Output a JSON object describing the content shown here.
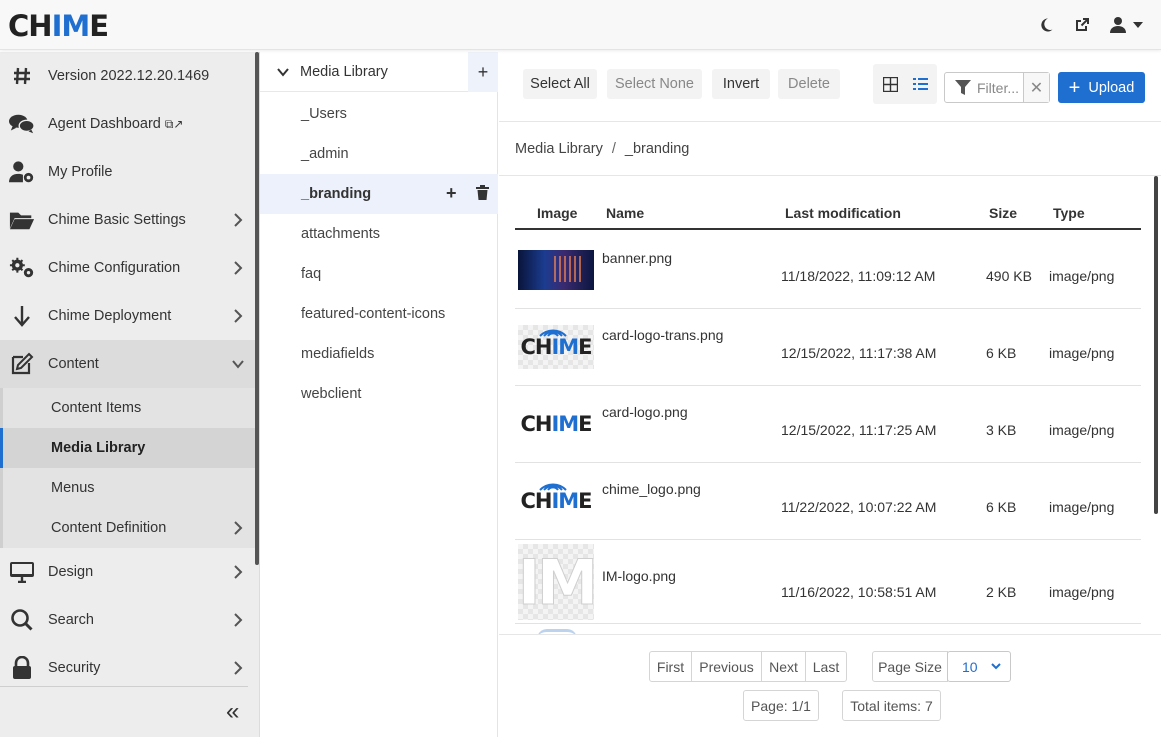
{
  "app": {
    "logo_pre": "CH",
    "logo_mid": "IM",
    "logo_post": "E",
    "accent": "#1f6fd1"
  },
  "header": {
    "icons": [
      "moon-icon",
      "external-link-icon",
      "user-icon",
      "caret-down-icon"
    ]
  },
  "sidebar": {
    "items": [
      {
        "label": "Version 2022.12.20.1469",
        "icon": "hash-icon"
      },
      {
        "label": "Agent Dashboard",
        "suffix": "⧉↗",
        "icon": "chat-icon"
      },
      {
        "label": "My Profile",
        "icon": "user-cog-icon"
      },
      {
        "label": "Chime Basic Settings",
        "icon": "folder-open-icon"
      },
      {
        "label": "Chime Configuration",
        "icon": "cogs-icon"
      },
      {
        "label": "Chime Deployment",
        "icon": "arrow-down-icon"
      },
      {
        "label": "Content",
        "icon": "edit-icon"
      },
      {
        "label": "Design",
        "icon": "monitor-icon"
      },
      {
        "label": "Search",
        "icon": "search-icon"
      },
      {
        "label": "Security",
        "icon": "lock-icon"
      }
    ],
    "content_sub": [
      {
        "label": "Content Items"
      },
      {
        "label": "Media Library"
      },
      {
        "label": "Menus"
      },
      {
        "label": "Content Definition"
      }
    ],
    "collapse_glyph": "«"
  },
  "tree": {
    "root": "Media Library",
    "folders": [
      "_Users",
      "_admin",
      "_branding",
      "attachments",
      "faq",
      "featured-content-icons",
      "mediafields",
      "webclient"
    ]
  },
  "toolbar": {
    "select_all": "Select All",
    "select_none": "Select None",
    "invert": "Invert",
    "delete": "Delete",
    "filter_placeholder": "Filter...",
    "upload": "Upload"
  },
  "breadcrumb": {
    "root": "Media Library",
    "sep": "/",
    "current": "_branding"
  },
  "table": {
    "headers": {
      "image": "Image",
      "name": "Name",
      "modified": "Last modification",
      "size": "Size",
      "type": "Type"
    },
    "rows": [
      {
        "name": "banner.png",
        "modified": "11/18/2022, 11:09:12 AM",
        "size": "490 KB",
        "type": "image/png"
      },
      {
        "name": "card-logo-trans.png",
        "modified": "12/15/2022, 11:17:38 AM",
        "size": "6 KB",
        "type": "image/png"
      },
      {
        "name": "card-logo.png",
        "modified": "12/15/2022, 11:17:25 AM",
        "size": "3 KB",
        "type": "image/png"
      },
      {
        "name": "chime_logo.png",
        "modified": "11/22/2022, 10:07:22 AM",
        "size": "6 KB",
        "type": "image/png"
      },
      {
        "name": "IM-logo.png",
        "modified": "11/16/2022, 10:58:51 AM",
        "size": "2 KB",
        "type": "image/png"
      }
    ]
  },
  "pager": {
    "first": "First",
    "previous": "Previous",
    "next": "Next",
    "last": "Last",
    "page_size_label": "Page Size",
    "page_size_value": "10",
    "page_info": "Page: 1/1",
    "total_items": "Total items: 7"
  }
}
